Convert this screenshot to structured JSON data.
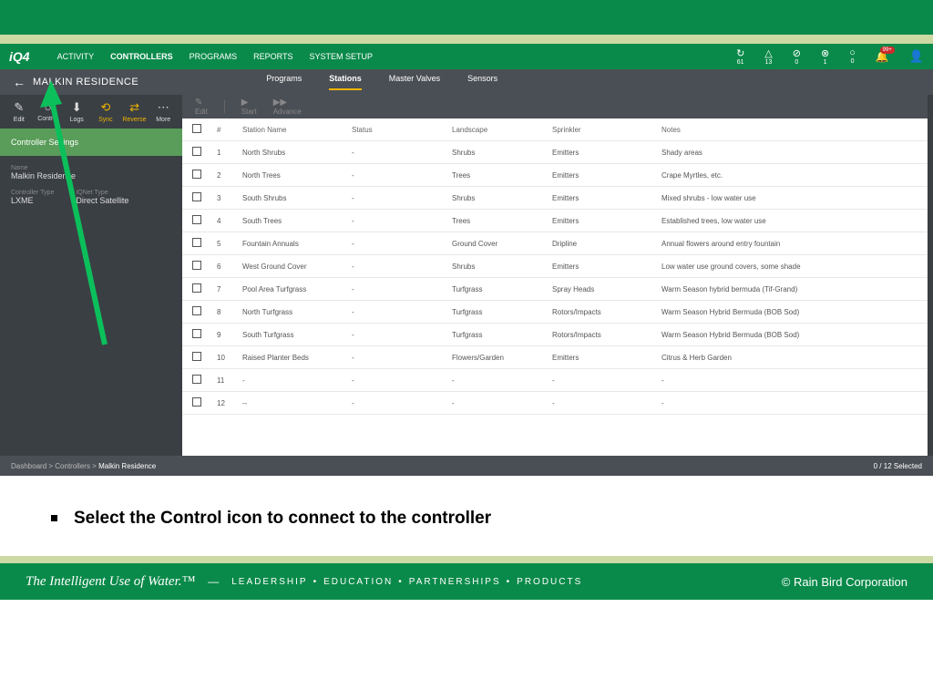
{
  "header": {
    "logo": "iQ4",
    "nav": [
      "ACTIVITY",
      "CONTROLLERS",
      "PROGRAMS",
      "REPORTS",
      "SYSTEM SETUP"
    ],
    "nav_active": 1,
    "stats": [
      {
        "icon": "↻",
        "num": "61"
      },
      {
        "icon": "△",
        "num": "13"
      },
      {
        "icon": "⊘",
        "num": "0"
      },
      {
        "icon": "⊗",
        "num": "1"
      },
      {
        "icon": "○",
        "num": "0"
      }
    ],
    "bell_badge": "99+"
  },
  "subheader": {
    "title": "MALKIN RESIDENCE",
    "tabs": [
      "Programs",
      "Stations",
      "Master Valves",
      "Sensors"
    ],
    "tab_active": 1
  },
  "side_tools": [
    {
      "icon": "✎",
      "label": "Edit"
    },
    {
      "icon": "○",
      "label": "Control"
    },
    {
      "icon": "⬇",
      "label": "Logs"
    },
    {
      "icon": "⟲",
      "label": "Sync",
      "hl": true
    },
    {
      "icon": "⇄",
      "label": "Reverse",
      "hl": true
    },
    {
      "icon": "⋯",
      "label": "More"
    }
  ],
  "side_panel_title": "Controller Settings",
  "side_info": {
    "name_lbl": "Name",
    "name_val": "Malkin Residence",
    "ctype_lbl": "Controller Type",
    "ctype_val": "LXME",
    "ntype_lbl": "IQNet Type",
    "ntype_val": "Direct Satellite"
  },
  "table_toolbar": [
    {
      "icon": "✎",
      "label": "Edit"
    },
    {
      "icon": "▶",
      "label": "Start"
    },
    {
      "icon": "▶▶",
      "label": "Advance"
    }
  ],
  "columns": [
    "",
    "#",
    "Station Name",
    "Status",
    "Landscape",
    "Sprinkler",
    "Notes"
  ],
  "rows": [
    {
      "n": "1",
      "name": "North Shrubs",
      "status": "-",
      "land": "Shrubs",
      "spr": "Emitters",
      "notes": "Shady areas"
    },
    {
      "n": "2",
      "name": "North Trees",
      "status": "-",
      "land": "Trees",
      "spr": "Emitters",
      "notes": "Crape Myrtles, etc."
    },
    {
      "n": "3",
      "name": "South Shrubs",
      "status": "-",
      "land": "Shrubs",
      "spr": "Emitters",
      "notes": "Mixed shrubs - low water use"
    },
    {
      "n": "4",
      "name": "South Trees",
      "status": "-",
      "land": "Trees",
      "spr": "Emitters",
      "notes": "Established trees, low water use"
    },
    {
      "n": "5",
      "name": "Fountain Annuals",
      "status": "-",
      "land": "Ground Cover",
      "spr": "Dripline",
      "notes": "Annual flowers around entry fountain"
    },
    {
      "n": "6",
      "name": "West Ground Cover",
      "status": "-",
      "land": "Shrubs",
      "spr": "Emitters",
      "notes": "Low water use ground covers, some shade"
    },
    {
      "n": "7",
      "name": "Pool Area Turfgrass",
      "status": "-",
      "land": "Turfgrass",
      "spr": "Spray Heads",
      "notes": "Warm Season hybrid bermuda (Tif-Grand)"
    },
    {
      "n": "8",
      "name": "North Turfgrass",
      "status": "-",
      "land": "Turfgrass",
      "spr": "Rotors/Impacts",
      "notes": "Warm Season Hybrid Bermuda (BOB Sod)"
    },
    {
      "n": "9",
      "name": "South Turfgrass",
      "status": "-",
      "land": "Turfgrass",
      "spr": "Rotors/Impacts",
      "notes": "Warm Season Hybrid Bermuda (BOB Sod)"
    },
    {
      "n": "10",
      "name": "Raised Planter Beds",
      "status": "-",
      "land": "Flowers/Garden",
      "spr": "Emitters",
      "notes": "Citrus & Herb Garden"
    },
    {
      "n": "11",
      "name": "-",
      "status": "-",
      "land": "-",
      "spr": "-",
      "notes": "-"
    },
    {
      "n": "12",
      "name": "--",
      "status": "-",
      "land": "-",
      "spr": "-",
      "notes": "-"
    }
  ],
  "breadcrumb": {
    "a": "Dashboard",
    "b": "Controllers",
    "c": "Malkin Residence",
    "sep": " > "
  },
  "selected_text": "0 / 12  Selected",
  "instruction": "Select the Control icon to connect to the controller",
  "footer": {
    "slogan": "The Intelligent Use of Water.™",
    "sep": "—",
    "words": [
      "LEADERSHIP",
      "EDUCATION",
      "PARTNERSHIPS",
      "PRODUCTS"
    ],
    "copyright": "© Rain Bird Corporation"
  }
}
